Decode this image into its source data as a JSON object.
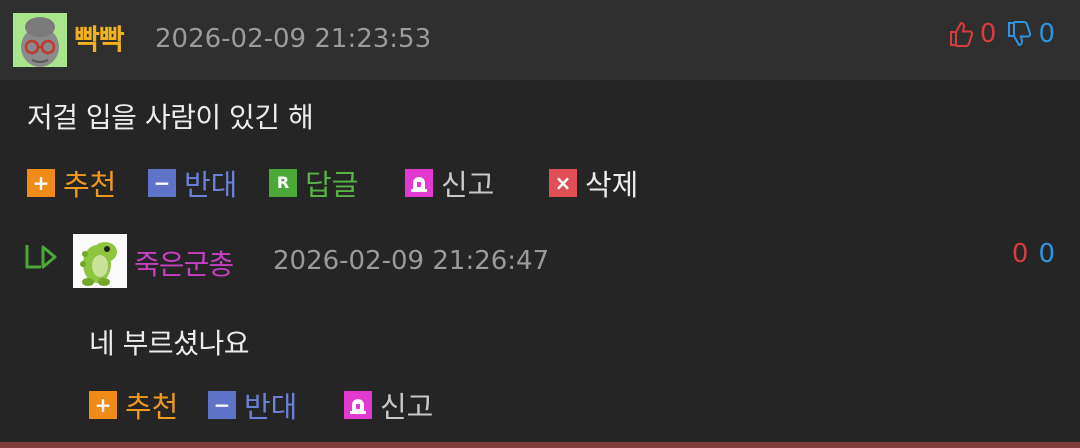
{
  "comment": {
    "author": "빡빡",
    "date": "2026-02-09 21:23:53",
    "upvotes": "0",
    "downvotes": "0",
    "text": "저걸 입을 사람이 있긴 해"
  },
  "actions": {
    "recommend": "추천",
    "oppose": "반대",
    "reply": "답글",
    "report": "신고",
    "delete": "삭제",
    "reply_box": "R"
  },
  "reply": {
    "author": "죽은군총",
    "date": "2026-02-09 21:26:47",
    "upvotes": "0",
    "downvotes": "0",
    "text": "네 부르셨나요"
  },
  "icons": {
    "thumb_up": "thumbs-up-icon",
    "thumb_down": "thumbs-down-icon",
    "reply_arrow": "reply-arrow-icon"
  },
  "colors": {
    "author1": "#f2b21e",
    "author2": "#c640c0",
    "upvote": "#d93c3c",
    "downvote": "#2e95e0",
    "recommend": "#f08a18",
    "oppose": "#5f73c8",
    "reply": "#4da83a",
    "report": "#e23ad0",
    "delete": "#e04f55"
  }
}
